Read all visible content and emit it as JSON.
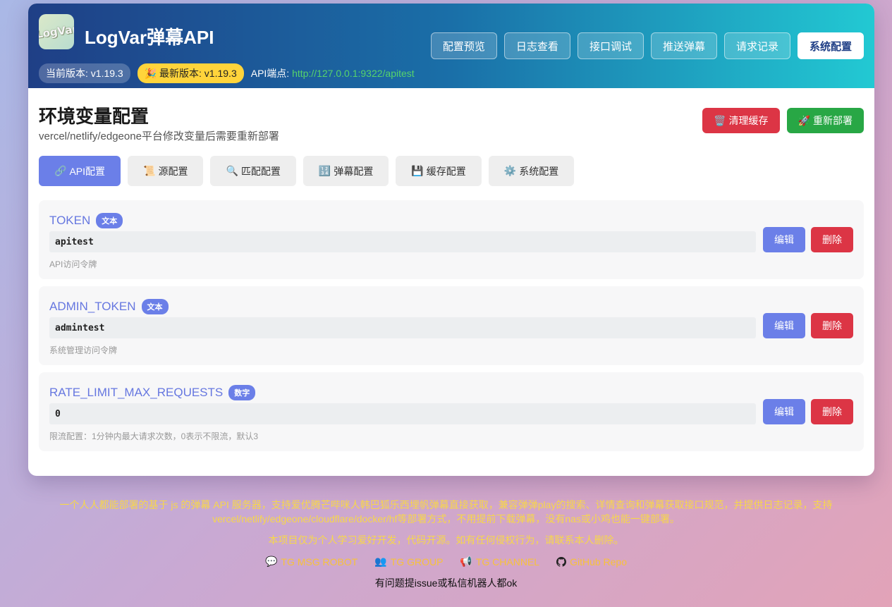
{
  "header": {
    "logo_text": "LogVar",
    "title": "LogVar弹幕API",
    "current_version": "当前版本: v1.19.3",
    "latest_version": "🎉 最新版本: v1.19.3",
    "endpoint_label": "API端点: ",
    "endpoint_url": "http://127.0.0.1:9322/apitest",
    "nav": [
      {
        "label": "配置预览"
      },
      {
        "label": "日志查看"
      },
      {
        "label": "接口调试"
      },
      {
        "label": "推送弹幕"
      },
      {
        "label": "请求记录"
      },
      {
        "label": "系统配置",
        "active": true
      }
    ]
  },
  "section": {
    "title": "环境变量配置",
    "subtitle": "vercel/netlify/edgeone平台修改变量后需要重新部署",
    "clear_cache": {
      "icon": "🗑️",
      "label": "清理缓存"
    },
    "redeploy": {
      "icon": "🚀",
      "label": "重新部署"
    }
  },
  "tabs": [
    {
      "icon": "🔗",
      "label": "API配置",
      "active": true
    },
    {
      "icon": "📜",
      "label": "源配置"
    },
    {
      "icon": "🔍",
      "label": "匹配配置"
    },
    {
      "icon": "🔢",
      "label": "弹幕配置"
    },
    {
      "icon": "💾",
      "label": "缓存配置"
    },
    {
      "icon": "⚙️",
      "label": "系统配置"
    }
  ],
  "env_items": [
    {
      "key": "TOKEN",
      "type": "文本",
      "value": "apitest",
      "desc": "API访问令牌",
      "edit": "编辑",
      "delete": "删除"
    },
    {
      "key": "ADMIN_TOKEN",
      "type": "文本",
      "value": "admintest",
      "desc": "系统管理访问令牌",
      "edit": "编辑",
      "delete": "删除"
    },
    {
      "key": "RATE_LIMIT_MAX_REQUESTS",
      "type": "数字",
      "value": "0",
      "desc": "限流配置：1分钟内最大请求次数，0表示不限流，默认3",
      "edit": "编辑",
      "delete": "删除"
    }
  ],
  "footer": {
    "description": "一个人人都能部署的基于 js 的弹幕 API 服务器，支持爱优腾芒哔咪人韩巴狐乐西埋帆弹幕直接获取，兼容弹弹play的搜索、详情查询和弹幕获取接口规范，并提供日志记录，支持vercel/netlify/edgeone/cloudflare/docker/hf等部署方式，不用提前下载弹幕，没有nas或小鸡也能一键部署。",
    "note": "本项目仅为个人学习爱好开发，代码开源。如有任何侵权行为，请联系本人删除。",
    "links": [
      {
        "icon": "💬",
        "label": "TG MSG ROBOT"
      },
      {
        "icon": "👥",
        "label": "TG GROUP"
      },
      {
        "icon": "📢",
        "label": "TG CHANNEL"
      },
      {
        "icon": "github-icon",
        "label": "GitHub Repo"
      }
    ],
    "contact": "有问题提issue或私信机器人都ok"
  },
  "colors": {
    "accent": "#6b7fe8",
    "danger": "#dc3545",
    "success": "#28a745",
    "header_start": "#1f3f86",
    "header_end": "#22c9d3",
    "footer_text": "#f7d74a"
  }
}
